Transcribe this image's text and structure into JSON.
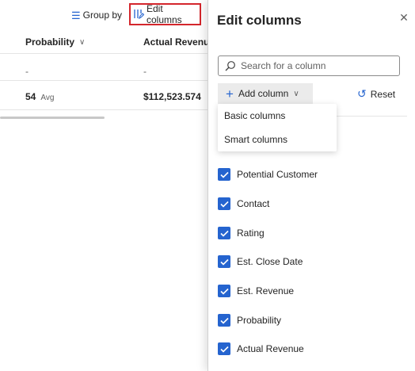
{
  "toolbar": {
    "group_by_label": "Group by",
    "edit_columns_label": "Edit columns"
  },
  "grid": {
    "columns": [
      {
        "label": "Probability"
      },
      {
        "label": "Actual Revenue"
      }
    ],
    "rows": [
      {
        "probability": "-",
        "actual_revenue": "-"
      }
    ],
    "aggregates": {
      "probability_value": "54",
      "probability_label": "Avg",
      "actual_revenue_value": "$112,523.574"
    }
  },
  "panel": {
    "title": "Edit columns",
    "search_placeholder": "Search for a column",
    "add_column_label": "Add column",
    "reset_label": "Reset",
    "menu_items": [
      "Basic columns",
      "Smart columns"
    ],
    "columns": [
      {
        "label": "Potential Customer",
        "checked": true
      },
      {
        "label": "Contact",
        "checked": true
      },
      {
        "label": "Rating",
        "checked": true
      },
      {
        "label": "Est. Close Date",
        "checked": true
      },
      {
        "label": "Est. Revenue",
        "checked": true
      },
      {
        "label": "Probability",
        "checked": true
      },
      {
        "label": "Actual Revenue",
        "checked": true
      }
    ]
  },
  "colors": {
    "accent": "#2564cf",
    "highlight_border": "#d4262c"
  }
}
